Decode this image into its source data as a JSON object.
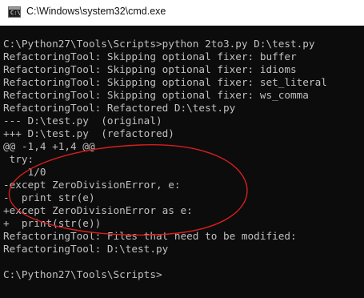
{
  "window": {
    "title": "C:\\Windows\\system32\\cmd.exe",
    "icon": "cmd-icon",
    "icon_glyph": "C:\\"
  },
  "console": {
    "lines": [
      "",
      "C:\\Python27\\Tools\\Scripts>python 2to3.py D:\\test.py",
      "RefactoringTool: Skipping optional fixer: buffer",
      "RefactoringTool: Skipping optional fixer: idioms",
      "RefactoringTool: Skipping optional fixer: set_literal",
      "RefactoringTool: Skipping optional fixer: ws_comma",
      "RefactoringTool: Refactored D:\\test.py",
      "--- D:\\test.py  (original)",
      "+++ D:\\test.py  (refactored)",
      "@@ -1,4 +1,4 @@",
      " try:",
      "    1/0",
      "-except ZeroDivisionError, e:",
      "-  print str(e)",
      "+except ZeroDivisionError as e:",
      "+  print(str(e))",
      "RefactoringTool: Files that need to be modified:",
      "RefactoringTool: D:\\test.py",
      "",
      "C:\\Python27\\Tools\\Scripts>"
    ]
  },
  "annotation": {
    "shape": "ellipse",
    "color": "#d81e1e"
  },
  "colors": {
    "console_bg": "#0c0c0c",
    "console_text": "#c0c0c0",
    "titlebar_bg": "#ffffff"
  }
}
